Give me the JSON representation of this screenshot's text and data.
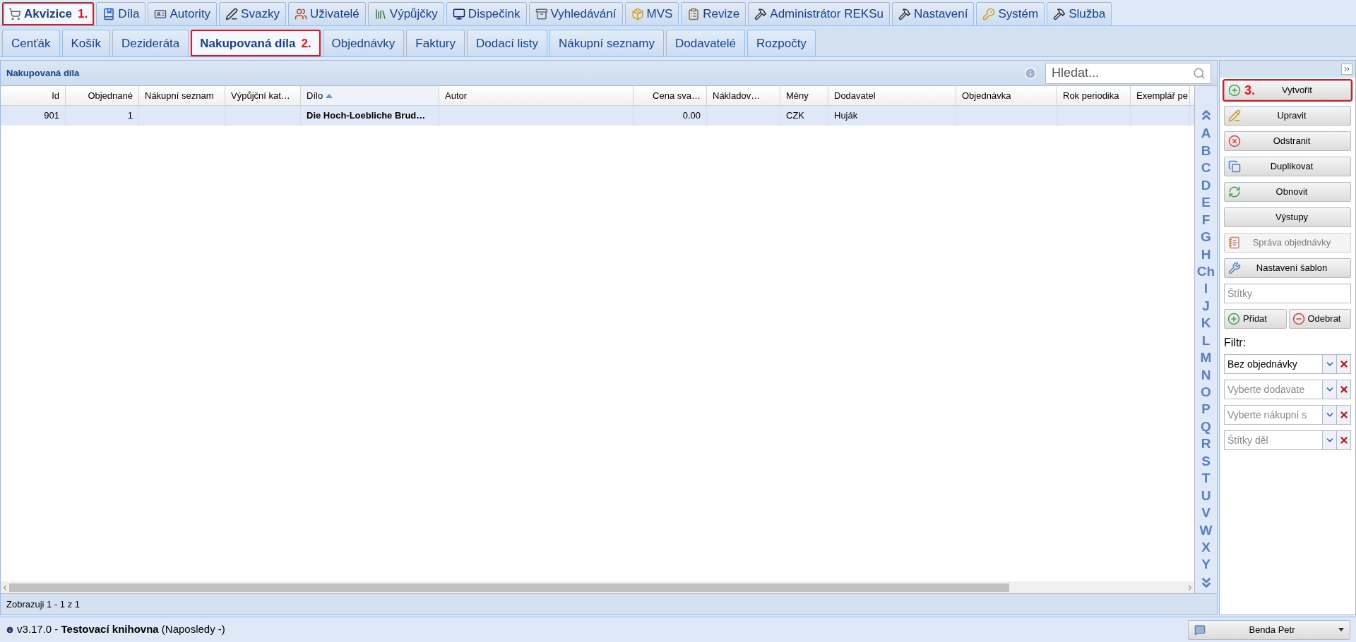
{
  "main_tabs": [
    {
      "label": "Akvizice",
      "selected": true,
      "callout": "1."
    },
    {
      "label": "Díla",
      "selected": false
    },
    {
      "label": "Autority",
      "selected": false
    },
    {
      "label": "Svazky",
      "selected": false
    },
    {
      "label": "Uživatelé",
      "selected": false
    },
    {
      "label": "Výpůjčky",
      "selected": false
    },
    {
      "label": "Dispečink",
      "selected": false
    },
    {
      "label": "Vyhledávání",
      "selected": false
    },
    {
      "label": "MVS",
      "selected": false
    },
    {
      "label": "Revize",
      "selected": false
    },
    {
      "label": "Administrátor REKSu",
      "selected": false
    },
    {
      "label": "Nastavení",
      "selected": false
    },
    {
      "label": "Systém",
      "selected": false
    },
    {
      "label": "Služba",
      "selected": false
    }
  ],
  "sub_tabs": [
    {
      "label": "Cenťák",
      "selected": false
    },
    {
      "label": "Košík",
      "selected": false
    },
    {
      "label": "Dezideráta",
      "selected": false
    },
    {
      "label": "Nakupovaná díla",
      "selected": true,
      "callout": "2."
    },
    {
      "label": "Objednávky",
      "selected": false
    },
    {
      "label": "Faktury",
      "selected": false
    },
    {
      "label": "Dodací listy",
      "selected": false
    },
    {
      "label": "Nákupní seznamy",
      "selected": false
    },
    {
      "label": "Dodavatelé",
      "selected": false
    },
    {
      "label": "Rozpočty",
      "selected": false
    }
  ],
  "panel": {
    "title": "Nakupovaná díla",
    "search": {
      "placeholder": "Hledat..."
    }
  },
  "table": {
    "columns": [
      {
        "label": "Id",
        "sorted": false
      },
      {
        "label": "Objednané",
        "sorted": false
      },
      {
        "label": "Nákupní seznam",
        "sorted": false
      },
      {
        "label": "Výpůjční kat…",
        "sorted": false
      },
      {
        "label": "Dílo",
        "sorted": true
      },
      {
        "label": "Autor",
        "sorted": false
      },
      {
        "label": "Cena sva…",
        "sorted": false
      },
      {
        "label": "Nákladov…",
        "sorted": false
      },
      {
        "label": "Měny",
        "sorted": false
      },
      {
        "label": "Dodavatel",
        "sorted": false
      },
      {
        "label": "Objednávka",
        "sorted": false
      },
      {
        "label": "Rok periodika",
        "sorted": false
      },
      {
        "label": "Exemplář pe",
        "sorted": false
      }
    ],
    "rows": [
      {
        "selected": true,
        "cells": [
          "901",
          "1",
          null,
          null,
          "Die Hoch-Loebliche Brud…",
          null,
          "0.00",
          null,
          "CZK",
          "Huják",
          null,
          null,
          null
        ]
      }
    ]
  },
  "alphabet": [
    "A",
    "B",
    "C",
    "D",
    "E",
    "F",
    "G",
    "H",
    "Ch",
    "I",
    "J",
    "K",
    "L",
    "M",
    "N",
    "O",
    "P",
    "Q",
    "R",
    "S",
    "T",
    "U",
    "V",
    "W",
    "X",
    "Y"
  ],
  "footer": "Zobrazuji 1 - 1 z 1",
  "actions": [
    {
      "label": "Vytvořit",
      "disabled": false,
      "callout": "3."
    },
    {
      "label": "Upravit",
      "disabled": false
    },
    {
      "label": "Odstranit",
      "disabled": false
    },
    {
      "label": "Duplikovat",
      "disabled": false
    },
    {
      "label": "Obnovit",
      "disabled": false
    },
    {
      "label": "Výstupy",
      "disabled": false
    },
    {
      "label": "Správa objednávky",
      "disabled": true
    },
    {
      "label": "Nastavení šablon",
      "disabled": false
    }
  ],
  "tag_field": {
    "placeholder": "Štítky"
  },
  "tag_buttons": [
    {
      "label": "Přidat"
    },
    {
      "label": "Odebrat"
    }
  ],
  "filter_label": "Filtr:",
  "filters": [
    {
      "value": "Bez objednávky"
    },
    {
      "placeholder": "Vyberte dodavate"
    },
    {
      "placeholder": "Vyberte nákupní s"
    },
    {
      "placeholder": "Štítky děl"
    }
  ],
  "status_bar": {
    "text": "v3.17.0 - **Testovací knihovna** (Naposledy -)",
    "user": "Benda Petr"
  }
}
